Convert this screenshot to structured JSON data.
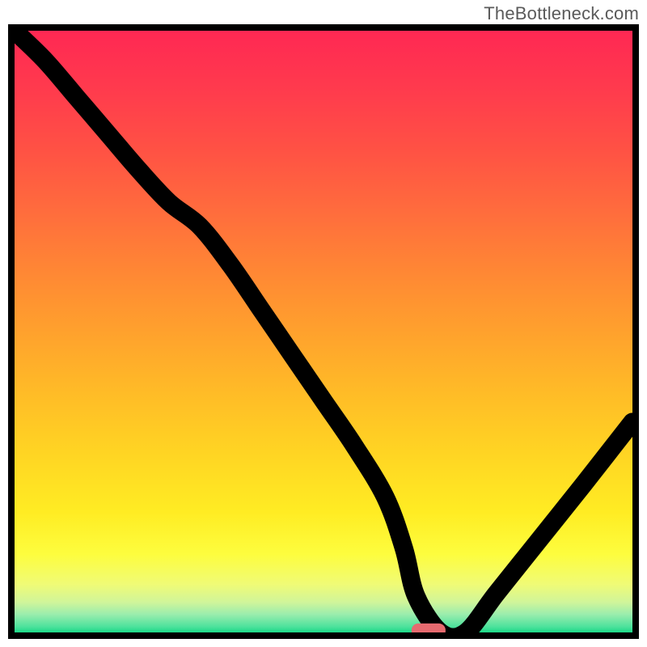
{
  "watermark": "TheBottleneck.com",
  "chart_data": {
    "type": "line",
    "title": "",
    "xlabel": "",
    "ylabel": "",
    "xlim": [
      0,
      100
    ],
    "ylim": [
      0,
      100
    ],
    "grid": false,
    "legend": false,
    "marker": {
      "x": 67,
      "y": 0,
      "color": "#e66a6f"
    },
    "series": [
      {
        "name": "curve",
        "x": [
          0,
          5,
          10,
          15,
          20,
          25,
          30,
          35,
          40,
          45,
          50,
          55,
          60,
          63,
          65,
          69,
          73,
          78,
          85,
          92,
          100
        ],
        "values": [
          100,
          95,
          89,
          83,
          77,
          71.5,
          67.5,
          61,
          53.5,
          46,
          38.5,
          31,
          22.5,
          14,
          6,
          0,
          0,
          6.5,
          15.5,
          24.5,
          35
        ]
      }
    ],
    "background_gradient": [
      {
        "y": 100,
        "color": "#ff2853"
      },
      {
        "y": 90,
        "color": "#ff3b4d"
      },
      {
        "y": 80,
        "color": "#ff5244"
      },
      {
        "y": 70,
        "color": "#ff6c3d"
      },
      {
        "y": 60,
        "color": "#ff8734"
      },
      {
        "y": 50,
        "color": "#ffa12d"
      },
      {
        "y": 40,
        "color": "#ffbb27"
      },
      {
        "y": 30,
        "color": "#ffd423"
      },
      {
        "y": 20,
        "color": "#ffec23"
      },
      {
        "y": 13,
        "color": "#fdfd3e"
      },
      {
        "y": 8,
        "color": "#f0fb76"
      },
      {
        "y": 5,
        "color": "#d0f59a"
      },
      {
        "y": 3,
        "color": "#9aedad"
      },
      {
        "y": 1,
        "color": "#4fe29d"
      },
      {
        "y": 0,
        "color": "#1bd987"
      }
    ]
  }
}
